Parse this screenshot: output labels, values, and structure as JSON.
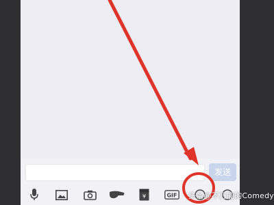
{
  "composer": {
    "input_value": "",
    "send_label": "发送"
  },
  "toolbar": {
    "icons": [
      "microphone-icon",
      "image-icon",
      "camera-icon",
      "poke-icon",
      "red-envelope-icon",
      "gif-icon",
      "emoji-icon",
      "plus-icon"
    ],
    "gif_label": "GIF",
    "red_envelope_symbol": "¥"
  },
  "annotation": {
    "color": "#e0342b"
  },
  "watermark": {
    "text": "头条@不万能的Comedy"
  }
}
